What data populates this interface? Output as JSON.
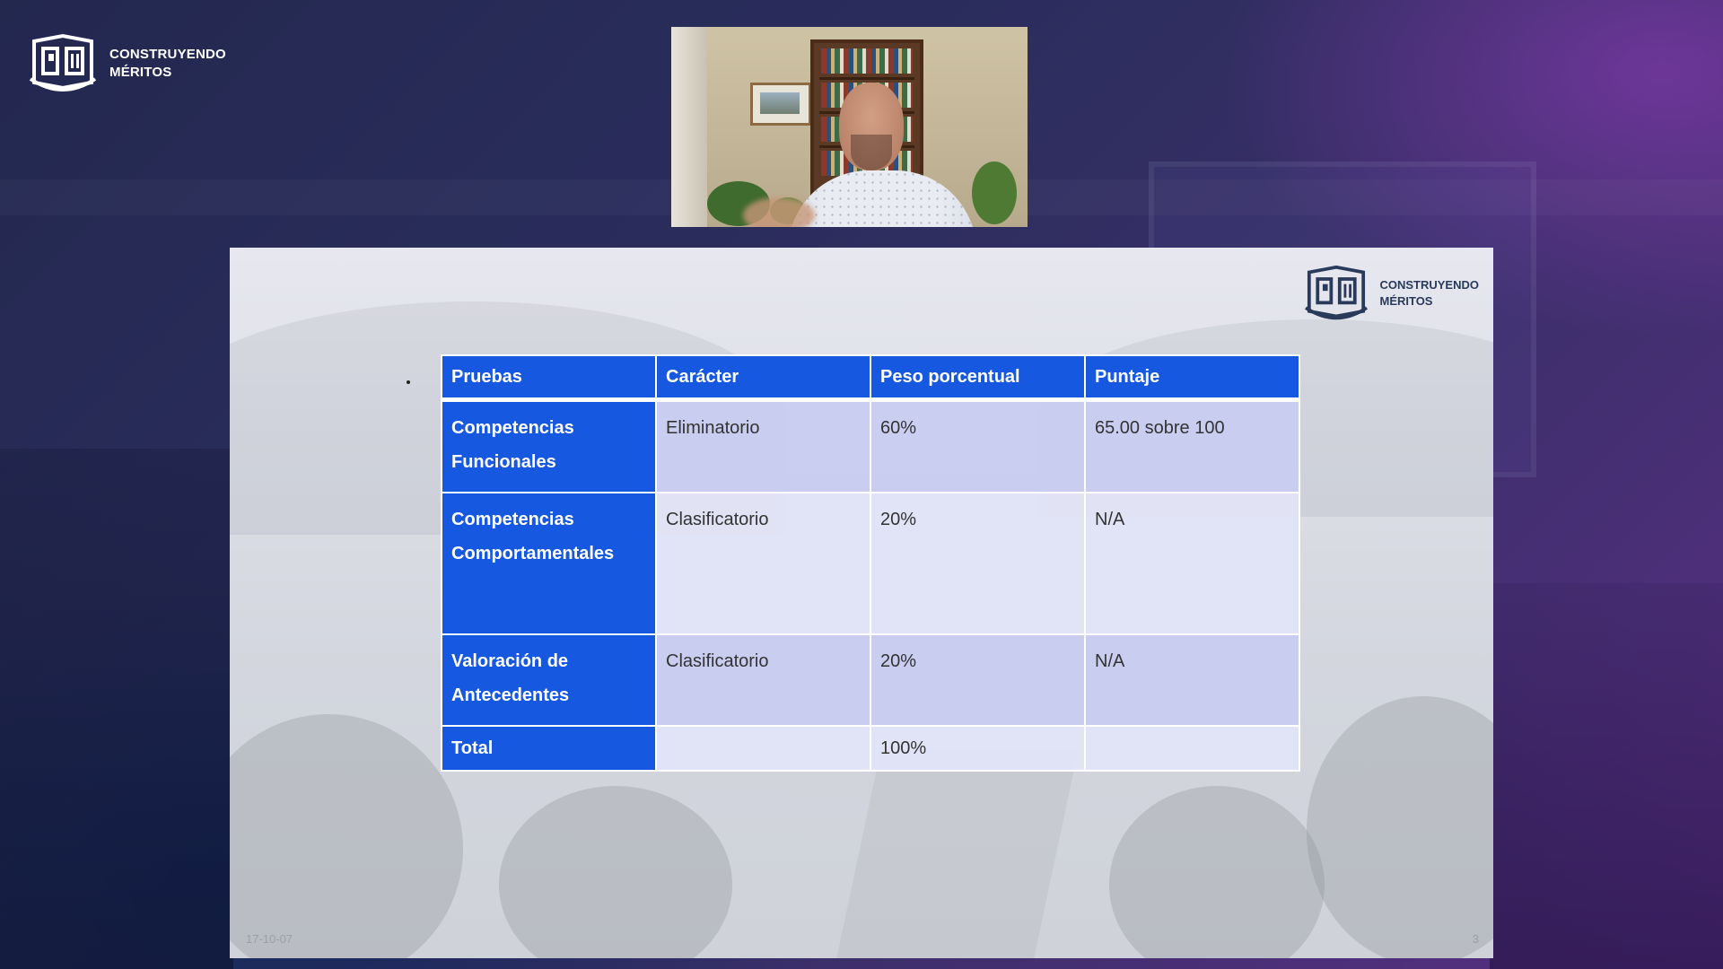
{
  "brand": {
    "line1": "CONSTRUYENDO",
    "line2": "MÉRITOS"
  },
  "slide": {
    "table": {
      "headers": [
        "Pruebas",
        "Carácter",
        "Peso porcentual",
        "Puntaje"
      ],
      "rows": [
        {
          "prueba_line1": "Competencias",
          "prueba_line2": "Funcionales",
          "caracter": "Eliminatorio",
          "peso": "60%",
          "puntaje": "65.00 sobre 100"
        },
        {
          "prueba_line1": "Competencias",
          "prueba_line2": "Comportamentales",
          "caracter": "Clasificatorio",
          "peso": "20%",
          "puntaje": "N/A"
        },
        {
          "prueba_line1": "Valoración de",
          "prueba_line2": "Antecedentes",
          "caracter": "Clasificatorio",
          "peso": "20%",
          "puntaje": "N/A"
        },
        {
          "prueba_line1": "Total",
          "prueba_line2": "",
          "caracter": "",
          "peso": "100%",
          "puntaje": ""
        }
      ]
    },
    "footer_date": "17-10-07",
    "page_number": "3"
  },
  "colors": {
    "header_blue": "#1758e0",
    "row_light": "#c8ccf0",
    "row_lighter": "#e2e4f7"
  },
  "icons": [
    "book-logo-icon"
  ]
}
